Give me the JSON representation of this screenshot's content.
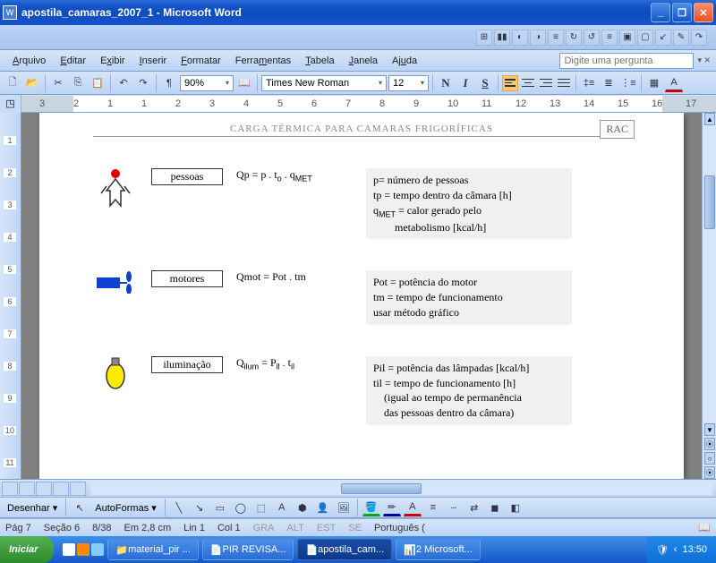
{
  "window": {
    "title": "apostila_camaras_2007_1 - Microsoft Word"
  },
  "menu": {
    "items": [
      "Arquivo",
      "Editar",
      "Exibir",
      "Inserir",
      "Formatar",
      "Ferramentas",
      "Tabela",
      "Janela",
      "Ajuda"
    ],
    "ask_placeholder": "Digite uma pergunta"
  },
  "toolbar": {
    "zoom": "90%",
    "font": "Times New Roman",
    "size": "12"
  },
  "ruler": {
    "marks": [
      "3",
      "2",
      "1",
      "1",
      "2",
      "3",
      "4",
      "5",
      "6",
      "7",
      "8",
      "9",
      "10",
      "11",
      "12",
      "13",
      "14",
      "15",
      "16",
      "17"
    ]
  },
  "doc": {
    "header": "CARGA TÉRMICA PARA CAMARAS FRIGORÍFICAS",
    "rac": "RAC",
    "rows": [
      {
        "label": "pessoas",
        "formula_html": "Qp = p . t<sub>o</sub> . q<sub>MET</sub>",
        "desc_html": "p= número de pessoas<br>tp = tempo dentro da câmara [h]<br>q<sub>MET</sub> = calor gerado pelo<br>&nbsp;&nbsp;&nbsp;&nbsp;&nbsp;&nbsp;&nbsp;&nbsp;metabolismo [kcal/h]"
      },
      {
        "label": "motores",
        "formula_html": "Qmot = Pot . tm",
        "desc_html": "Pot = potência do motor<br>tm = tempo de funcionamento<br>usar método gráfico"
      },
      {
        "label": "iluminação",
        "formula_html": "Q<sub>ilum</sub> = P<sub>il</sub> . t<sub>il</sub>",
        "desc_html": "Pil = potência das lâmpadas [kcal/h]<br>til = tempo de funcionamento [h]<br>&nbsp;&nbsp;&nbsp;&nbsp;(igual ao tempo de permanência<br>&nbsp;&nbsp;&nbsp;&nbsp;das pessoas dentro da câmara)"
      }
    ]
  },
  "draw": {
    "label": "Desenhar",
    "autoshapes": "AutoFormas"
  },
  "status": {
    "page": "Pág 7",
    "section": "Seção 6",
    "pages": "8/38",
    "at": "Em  2,8 cm",
    "line": "Lin  1",
    "col": "Col  1",
    "gra": "GRA",
    "alt": "ALT",
    "est": "EST",
    "se": "SE",
    "lang": "Português ("
  },
  "taskbar": {
    "start": "Iniciar",
    "tasks": [
      "material_pir ...",
      "PIR REVISA...",
      "apostila_cam...",
      "2 Microsoft..."
    ],
    "time": "13:50"
  }
}
